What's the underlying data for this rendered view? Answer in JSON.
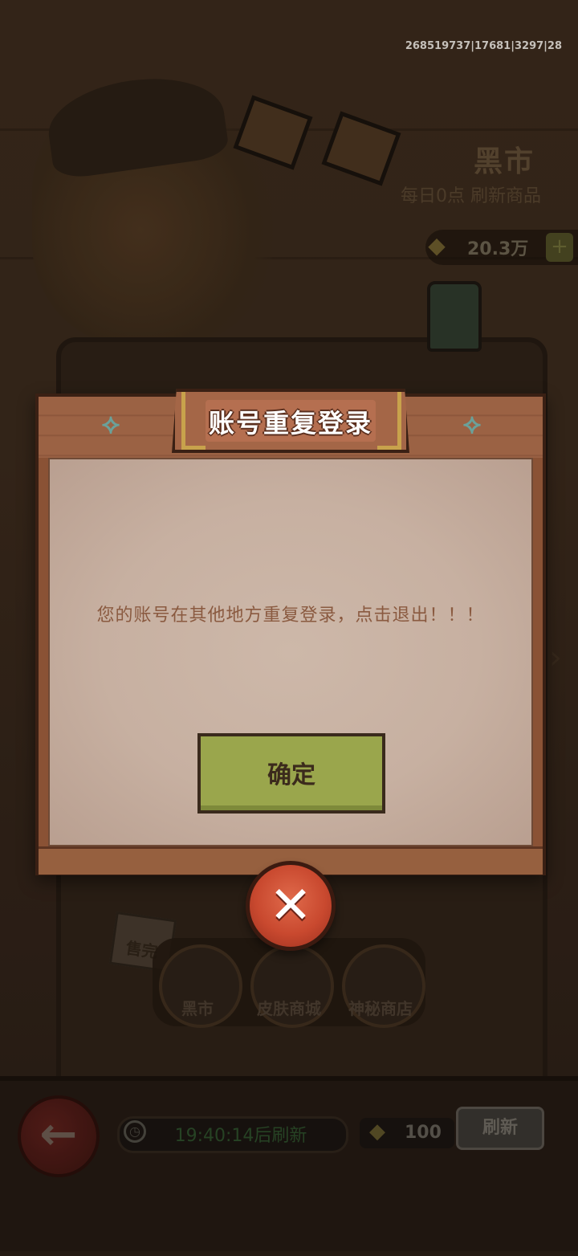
{
  "debug": {
    "id_text": "268519737|17681|3297|28"
  },
  "shop": {
    "title": "黑市",
    "refresh_note": "每日0点 刷新商品",
    "currency_value": "20.3万",
    "currency_icon": "coupon-icon",
    "currency_plus": "+"
  },
  "tabs": [
    {
      "label": "黑市"
    },
    {
      "label": "皮肤商城"
    },
    {
      "label": "神秘商店"
    }
  ],
  "sticky_note": "售完",
  "bottom": {
    "back_icon": "back-arrow-icon",
    "timer_text": "19:40:14后刷新",
    "cost_value": "100",
    "refresh_label": "刷新"
  },
  "dialog": {
    "title": "账号重复登录",
    "message": "您的账号在其他地方重复登录，点击退出！！！",
    "confirm_label": "确定",
    "close_icon": "close-icon"
  },
  "colors": {
    "frame_wood": "#8a5235",
    "paper": "#c7b0a1",
    "confirm_green": "#9aa64c",
    "close_red": "#c9492f",
    "message_text": "#8a5a40"
  }
}
